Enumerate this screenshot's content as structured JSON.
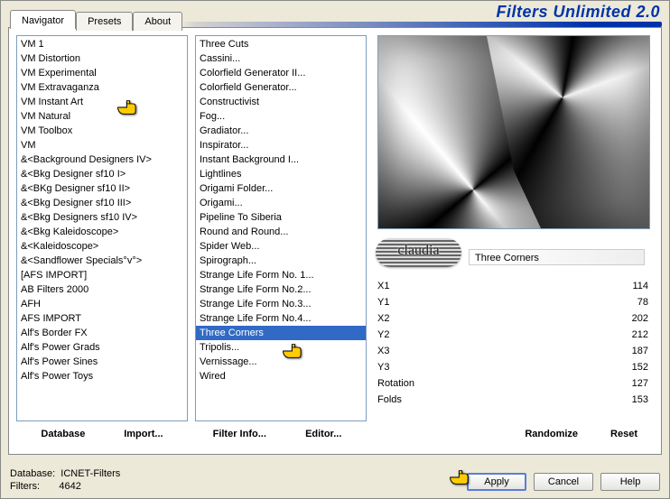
{
  "app_title": "Filters Unlimited 2.0",
  "tabs": {
    "navigator": "Navigator",
    "presets": "Presets",
    "about": "About"
  },
  "categories": [
    "VM 1",
    "VM Distortion",
    "VM Experimental",
    "VM Extravaganza",
    "VM Instant Art",
    "VM Natural",
    "VM Toolbox",
    "VM",
    "&<Background Designers IV>",
    "&<Bkg Designer sf10 I>",
    "&<BKg Designer sf10 II>",
    "&<Bkg Designer sf10 III>",
    "&<Bkg Designers sf10 IV>",
    "&<Bkg Kaleidoscope>",
    "&<Kaleidoscope>",
    "&<Sandflower Specials°v°>",
    "[AFS IMPORT]",
    "AB Filters 2000",
    "AFH",
    "AFS IMPORT",
    "Alf's Border FX",
    "Alf's Power Grads",
    "Alf's Power Sines",
    "Alf's Power Toys"
  ],
  "selected_category": "VM Instant Art",
  "filters": [
    "Three Cuts",
    "Cassini...",
    "Colorfield Generator II...",
    "Colorfield Generator...",
    "Constructivist",
    "Fog...",
    "Gradiator...",
    "Inspirator...",
    "Instant Background I...",
    "Lightlines",
    "Origami Folder...",
    "Origami...",
    "Pipeline To Siberia",
    "Round and Round...",
    "Spider Web...",
    "Spirograph...",
    "Strange Life Form No. 1...",
    "Strange Life Form No.2...",
    "Strange Life Form No.3...",
    "Strange Life Form No.4...",
    "Three Corners",
    "Tripolis...",
    "Vernissage...",
    "Wired"
  ],
  "selected_filter": "Three Corners",
  "current_filter_name": "Three Corners",
  "params": [
    {
      "label": "X1",
      "value": 114
    },
    {
      "label": "Y1",
      "value": 78
    },
    {
      "label": "X2",
      "value": 202
    },
    {
      "label": "Y2",
      "value": 212
    },
    {
      "label": "X3",
      "value": 187
    },
    {
      "label": "Y3",
      "value": 152
    },
    {
      "label": "Rotation",
      "value": 127
    },
    {
      "label": "Folds",
      "value": 153
    }
  ],
  "links": {
    "database": "Database",
    "import": "Import...",
    "filter_info": "Filter Info...",
    "editor": "Editor...",
    "randomize": "Randomize",
    "reset": "Reset"
  },
  "footer": {
    "db_label": "Database:",
    "db_value": "ICNET-Filters",
    "filters_label": "Filters:",
    "filters_value": "4642"
  },
  "buttons": {
    "apply": "Apply",
    "cancel": "Cancel",
    "help": "Help"
  }
}
